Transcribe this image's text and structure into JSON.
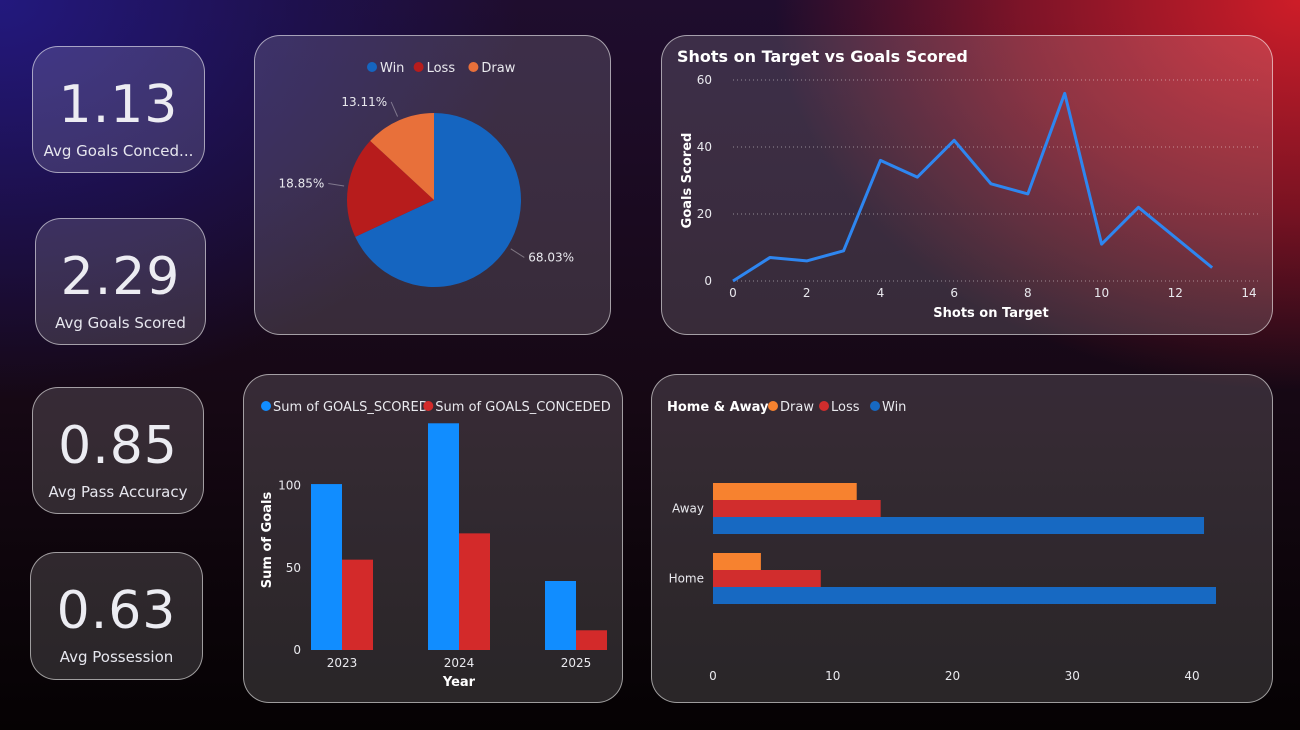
{
  "kpis": [
    {
      "value": "1.13",
      "label": "Avg Goals Conced..."
    },
    {
      "value": "2.29",
      "label": "Avg Goals Scored"
    },
    {
      "value": "0.85",
      "label": "Avg Pass Accuracy"
    },
    {
      "value": "0.63",
      "label": "Avg Possession"
    }
  ],
  "colors": {
    "win": "#1565c0",
    "loss": "#b71c1c",
    "draw": "#e8703a",
    "line": "#2e86f0",
    "scored": "#118dff",
    "conceded": "#d32a2a",
    "bar_win": "#1769c2",
    "bar_loss": "#d12d2d",
    "bar_draw": "#f7822f"
  },
  "chart_data": [
    {
      "type": "pie",
      "legend": [
        "Win",
        "Loss",
        "Draw"
      ],
      "legend_position": "top",
      "slices": [
        {
          "label": "Win",
          "value": 68.03,
          "text": "68.03%"
        },
        {
          "label": "Loss",
          "value": 18.85,
          "text": "18.85%"
        },
        {
          "label": "Draw",
          "value": 13.11,
          "text": "13.11%"
        }
      ]
    },
    {
      "type": "line",
      "title": "Shots on Target vs Goals Scored",
      "xlabel": "Shots on Target",
      "ylabel": "Goals Scored",
      "x": [
        0,
        1,
        2,
        3,
        4,
        5,
        6,
        7,
        8,
        9,
        10,
        11,
        12,
        13
      ],
      "y": [
        0,
        7,
        6,
        9,
        36,
        31,
        42,
        29,
        26,
        56,
        11,
        22,
        13,
        4
      ],
      "xlim": [
        0,
        14
      ],
      "ylim": [
        0,
        60
      ],
      "xticks": [
        "0",
        "2",
        "4",
        "6",
        "8",
        "10",
        "12",
        "14"
      ],
      "yticks": [
        "0",
        "20",
        "40",
        "60"
      ],
      "grid": true
    },
    {
      "type": "bar",
      "legend": [
        "Sum of GOALS_SCORED",
        "Sum of GOALS_CONCEDED"
      ],
      "legend_position": "top-left",
      "categories": [
        "2023",
        "2024",
        "2025"
      ],
      "series": [
        {
          "name": "Sum of GOALS_SCORED",
          "values": [
            101,
            138,
            42
          ]
        },
        {
          "name": "Sum of GOALS_CONCEDED",
          "values": [
            55,
            71,
            12
          ]
        }
      ],
      "xlabel": "Year",
      "ylabel": "Sum of Goals",
      "ylim": [
        0,
        140
      ],
      "yticks": [
        "0",
        "50",
        "100"
      ]
    },
    {
      "type": "bar",
      "orientation": "horizontal",
      "title": "Home & Away",
      "legend": [
        "Draw",
        "Loss",
        "Win"
      ],
      "legend_position": "top-left",
      "categories": [
        "Away",
        "Home"
      ],
      "series": [
        {
          "name": "Draw",
          "values": [
            12,
            4
          ]
        },
        {
          "name": "Loss",
          "values": [
            14,
            9
          ]
        },
        {
          "name": "Win",
          "values": [
            41,
            42
          ]
        }
      ],
      "xlim": [
        0,
        42
      ],
      "xticks": [
        "0",
        "10",
        "20",
        "30",
        "40"
      ],
      "grid": false
    }
  ]
}
